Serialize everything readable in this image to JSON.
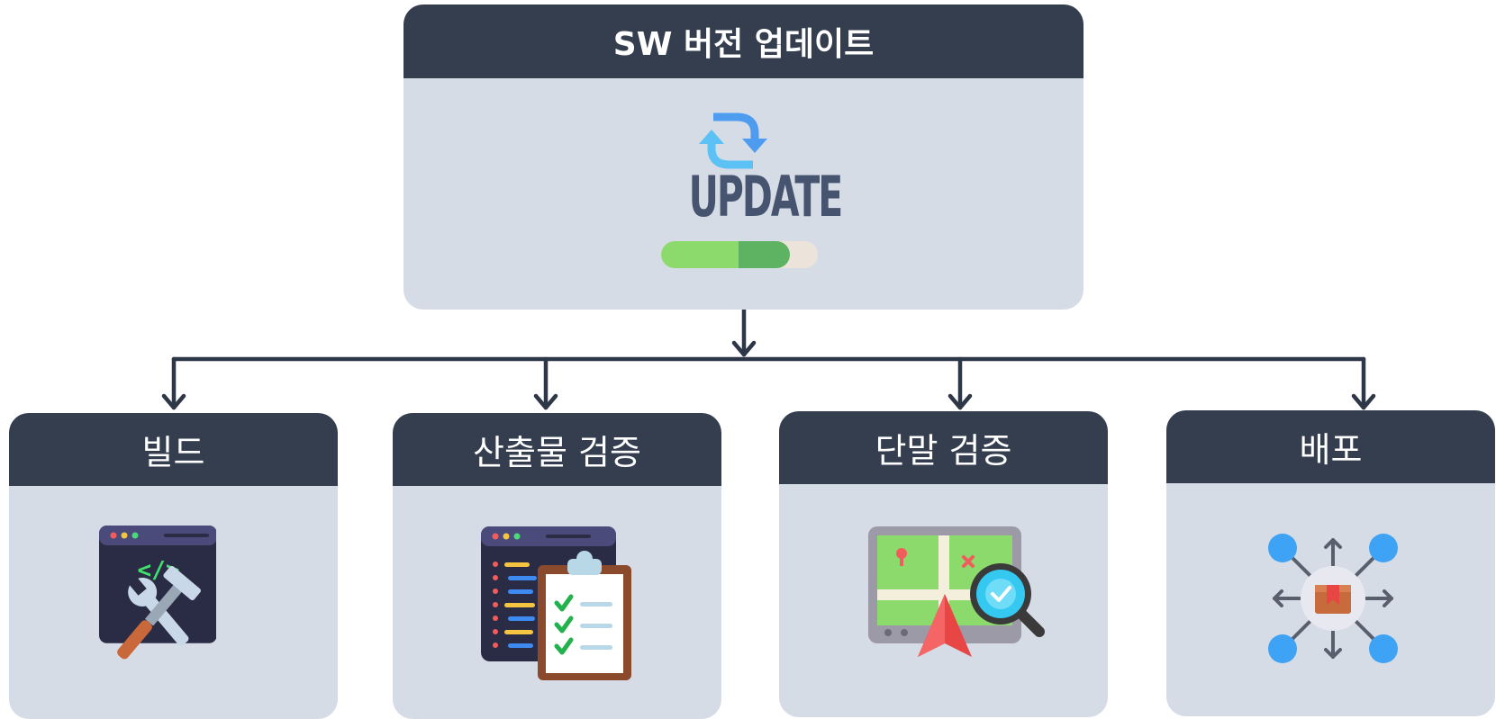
{
  "top": {
    "title": "SW 버전 업데이트",
    "icon_name": "update-icon",
    "icon_text": "UPDATE",
    "progress": 0.82
  },
  "steps": [
    {
      "label": "빌드",
      "icon": "build-tools-icon"
    },
    {
      "label": "산출물 검증",
      "icon": "checklist-clipboard-icon"
    },
    {
      "label": "단말 검증",
      "icon": "map-inspection-icon"
    },
    {
      "label": "배포",
      "icon": "distribution-icon"
    }
  ],
  "colors": {
    "header": "#343e4f",
    "card": "#d6dce6",
    "connector": "#2d3748"
  }
}
